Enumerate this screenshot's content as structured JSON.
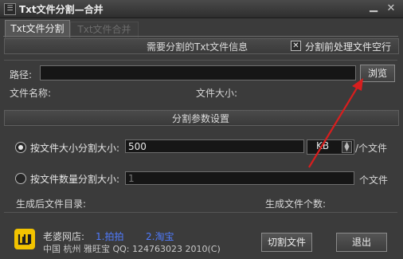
{
  "window": {
    "title": "Txt文件分割—合并",
    "app_icon": "☰",
    "minimize_glyph": "▁",
    "close_glyph": "✕"
  },
  "tabs": [
    {
      "label": "Txt文件分割",
      "active": true
    },
    {
      "label": "Txt文件合并",
      "active": false
    }
  ],
  "file_info": {
    "section_title": "需要分割的Txt文件信息",
    "preprocess_checkbox": {
      "label": "分割前处理文件空行",
      "checked": true,
      "mark": "✕"
    },
    "path_label": "路径:",
    "path_value": "",
    "browse_label": "浏览",
    "file_name_label": "文件名称:",
    "file_size_label": "文件大小:"
  },
  "split_settings": {
    "section_title": "分割参数设置",
    "by_size": {
      "label": "按文件大小分割大小:",
      "selected": true,
      "value": "500",
      "unit": "KB",
      "suffix": "/个文件"
    },
    "by_count": {
      "label": "按文件数量分割大小:",
      "selected": false,
      "value": "1",
      "suffix": "个文件"
    },
    "output_dir_label": "生成后文件目录:",
    "output_count_label": "生成文件个数:"
  },
  "footer": {
    "shop_label": "老婆网店:",
    "link_paipai": "1.拍拍",
    "link_taobao": "2.淘宝",
    "contact": "中国 杭州 雅旺宝  QQ: 124763023  2010(C)",
    "split_button": "切割文件",
    "exit_button": "退出"
  },
  "colors": {
    "annotation_arrow": "#d81e1e",
    "link": "#4f7bff",
    "logo": "#f2c300"
  }
}
